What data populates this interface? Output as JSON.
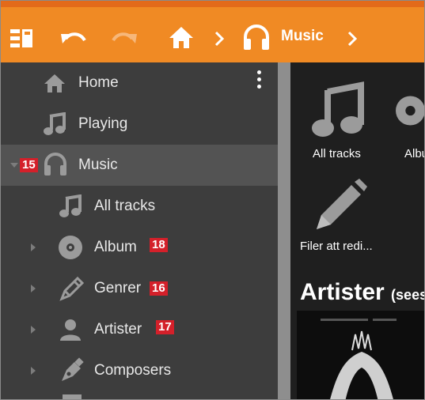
{
  "toolbar": {
    "breadcrumb_music": "Music"
  },
  "sidebar": {
    "items": [
      {
        "label": "Home"
      },
      {
        "label": "Playing"
      },
      {
        "label": "Music",
        "badge": "15"
      },
      {
        "label": "All tracks"
      },
      {
        "label": "Album",
        "badge": "18"
      },
      {
        "label": "Genrer",
        "badge": "16"
      },
      {
        "label": "Artister",
        "badge": "17"
      },
      {
        "label": "Composers"
      }
    ]
  },
  "content": {
    "tiles": [
      {
        "label": "All tracks"
      },
      {
        "label": "Albu"
      },
      {
        "label": "Filer att redi..."
      }
    ],
    "section_title": "Artister",
    "section_subtitle": "(sees"
  },
  "colors": {
    "toolbar": "#f08a24",
    "sidebar": "#3d3d3d",
    "selected_row": "#535353",
    "badge": "#d4202a"
  }
}
